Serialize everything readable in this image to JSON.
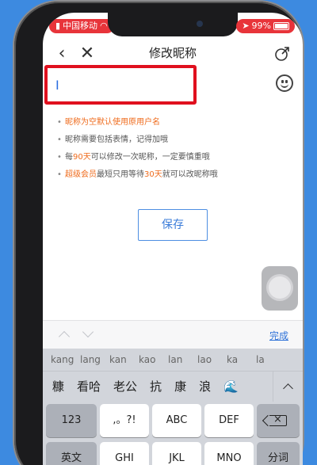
{
  "status_bar": {
    "carrier": "中国移动",
    "battery": "99%"
  },
  "nav": {
    "title": "修改昵称"
  },
  "name_input": {
    "value": "I"
  },
  "rules": [
    {
      "parts": [
        {
          "text": "昵称为空默认使用原用户名",
          "highlight": true
        }
      ]
    },
    {
      "parts": [
        {
          "text": "昵称需要包括表情，记得加哦",
          "highlight": false
        }
      ]
    },
    {
      "parts": [
        {
          "text": "每",
          "highlight": false
        },
        {
          "text": "90天",
          "highlight": true
        },
        {
          "text": "可以修改一次昵称，一定要慎重哦",
          "highlight": false
        }
      ]
    },
    {
      "parts": [
        {
          "text": "超级会员",
          "highlight": true
        },
        {
          "text": "最短只用等待",
          "highlight": false
        },
        {
          "text": "30天",
          "highlight": true
        },
        {
          "text": "就可以改昵称哦",
          "highlight": false
        }
      ]
    }
  ],
  "save_label": "保存",
  "toolbar": {
    "done_label": "完成"
  },
  "keyboard": {
    "pinyin": [
      "kang",
      "lang",
      "kan",
      "kao",
      "lan",
      "lao",
      "ka",
      "la"
    ],
    "candidates": [
      "糠",
      "看哈",
      "老公",
      "抗",
      "康",
      "浪"
    ],
    "keys": {
      "num": "123",
      "punct": ",。?!",
      "abc": "ABC",
      "def": "DEF",
      "ghi": "GHI",
      "jkl": "JKL",
      "mno": "MNO",
      "lang": "英文",
      "split": "分词"
    }
  },
  "colors": {
    "highlight": "#ef6b1c",
    "accent": "#2f72d8",
    "annotation": "#e0101e",
    "status_pill": "#e8343a",
    "background": "#3d8ae0"
  }
}
